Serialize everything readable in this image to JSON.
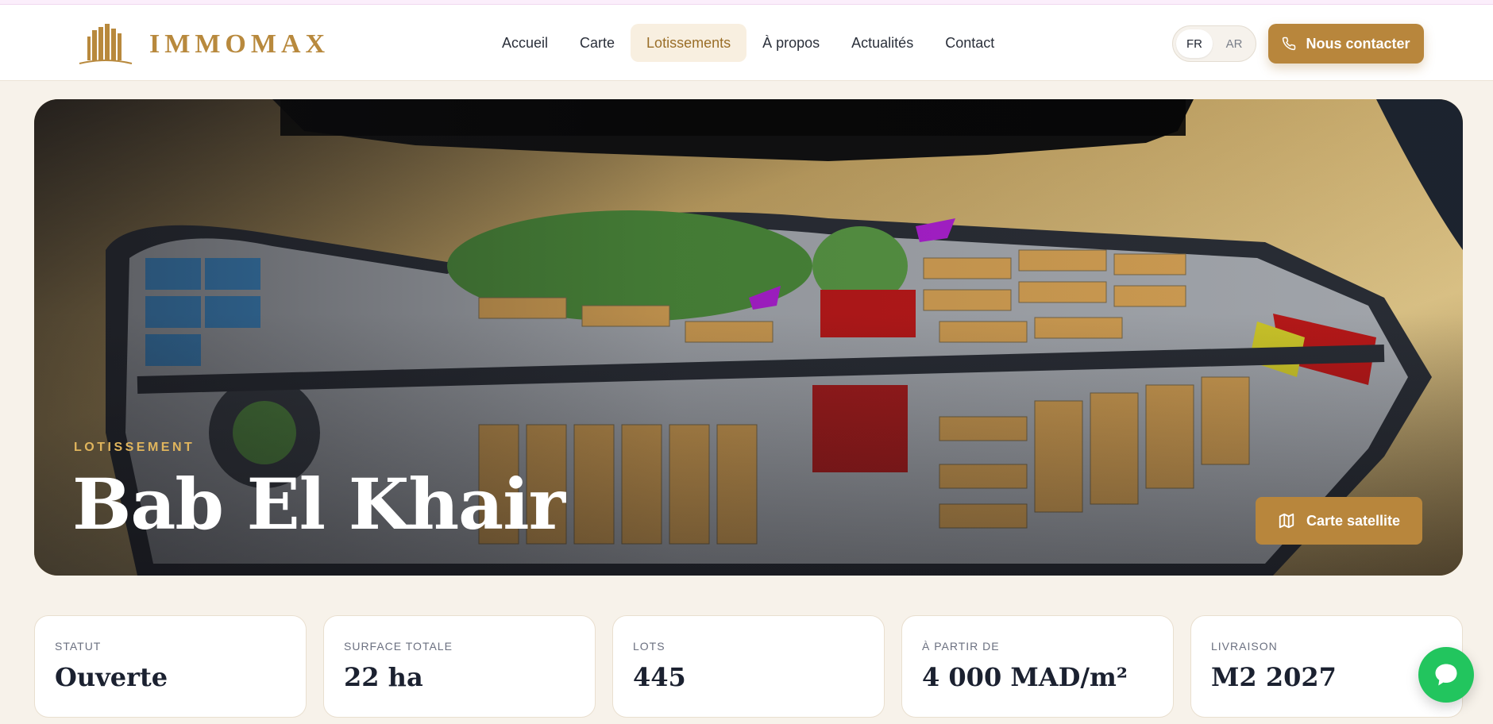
{
  "brand": {
    "name": "IMMOMAX",
    "logo_icon": "building-logo-icon",
    "accent_color": "#b8863c"
  },
  "nav": {
    "items": [
      {
        "label": "Accueil",
        "active": false
      },
      {
        "label": "Carte",
        "active": false
      },
      {
        "label": "Lotissements",
        "active": true
      },
      {
        "label": "À propos",
        "active": false
      },
      {
        "label": "Actualités",
        "active": false
      },
      {
        "label": "Contact",
        "active": false
      }
    ]
  },
  "language": {
    "options": [
      "FR",
      "AR"
    ],
    "selected": "FR"
  },
  "header": {
    "contact_label": "Nous contacter",
    "contact_icon": "phone-icon"
  },
  "hero": {
    "image": "masterplan-illustration",
    "eyebrow": "LOTISSEMENT",
    "title": "Bab El Khair",
    "map_button_label": "Carte satellite",
    "map_button_icon": "map-icon"
  },
  "stats": [
    {
      "label": "STATUT",
      "value": "Ouverte"
    },
    {
      "label": "SURFACE TOTALE",
      "value": "22 ha"
    },
    {
      "label": "LOTS",
      "value": "445"
    },
    {
      "label": "À PARTIR DE",
      "value": "4 000 MAD/m²"
    },
    {
      "label": "LIVRAISON",
      "value": "M2 2027"
    }
  ],
  "chat": {
    "icon": "chat-bubble-icon",
    "color": "#22c55e"
  }
}
